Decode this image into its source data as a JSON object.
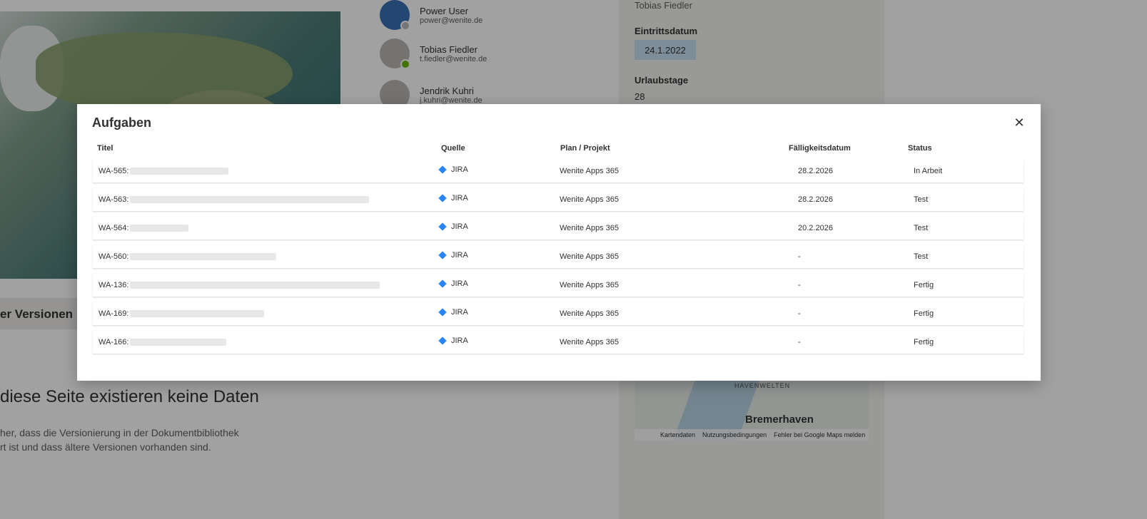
{
  "background": {
    "versions_title": "er Versionen",
    "nodata_title": "diese Seite existieren keine Daten",
    "nodata_hint_1": "her, dass die Versionierung in der Dokumentbibliothek",
    "nodata_hint_2": "rt ist und dass ältere Versionen vorhanden sind.",
    "people": [
      {
        "name": "Power User",
        "email": "power@wenite.de"
      },
      {
        "name": "Tobias Fiedler",
        "email": "t.fiedler@wenite.de"
      },
      {
        "name": "Jendrik Kuhri",
        "email": "j.kuhri@wenite.de"
      }
    ],
    "right": {
      "top_name": "Tobias Fiedler",
      "eintrittsdatum_label": "Eintrittsdatum",
      "eintrittsdatum_value": "24.1.2022",
      "urlaubstage_label": "Urlaubstage",
      "urlaubstage_value": "28",
      "map_area": "HAVENWELTEN",
      "map_city": "Bremerhaven",
      "map_footer": [
        "Kartendaten",
        "Nutzungsbedingungen",
        "Fehler bei Google Maps melden"
      ]
    }
  },
  "modal": {
    "title": "Aufgaben",
    "close_label": "✕",
    "columns": {
      "titel": "Titel",
      "quelle": "Quelle",
      "plan": "Plan / Projekt",
      "faellig": "Fälligkeitsdatum",
      "status": "Status"
    },
    "rows": [
      {
        "id": "WA-565:",
        "source": "JIRA",
        "plan": "Wenite Apps 365",
        "due": "28.2.2026",
        "status": "In Arbeit"
      },
      {
        "id": "WA-563:",
        "source": "JIRA",
        "plan": "Wenite Apps 365",
        "due": "28.2.2026",
        "status": "Test"
      },
      {
        "id": "WA-564:",
        "source": "JIRA",
        "plan": "Wenite Apps 365",
        "due": "20.2.2026",
        "status": "Test"
      },
      {
        "id": "WA-560:",
        "source": "JIRA",
        "plan": "Wenite Apps 365",
        "due": "-",
        "status": "Test"
      },
      {
        "id": "WA-136:",
        "source": "JIRA",
        "plan": "Wenite Apps 365",
        "due": "-",
        "status": "Fertig"
      },
      {
        "id": "WA-169:",
        "source": "JIRA",
        "plan": "Wenite Apps 365",
        "due": "-",
        "status": "Fertig"
      },
      {
        "id": "WA-166:",
        "source": "JIRA",
        "plan": "Wenite Apps 365",
        "due": "-",
        "status": "Fertig"
      }
    ]
  }
}
